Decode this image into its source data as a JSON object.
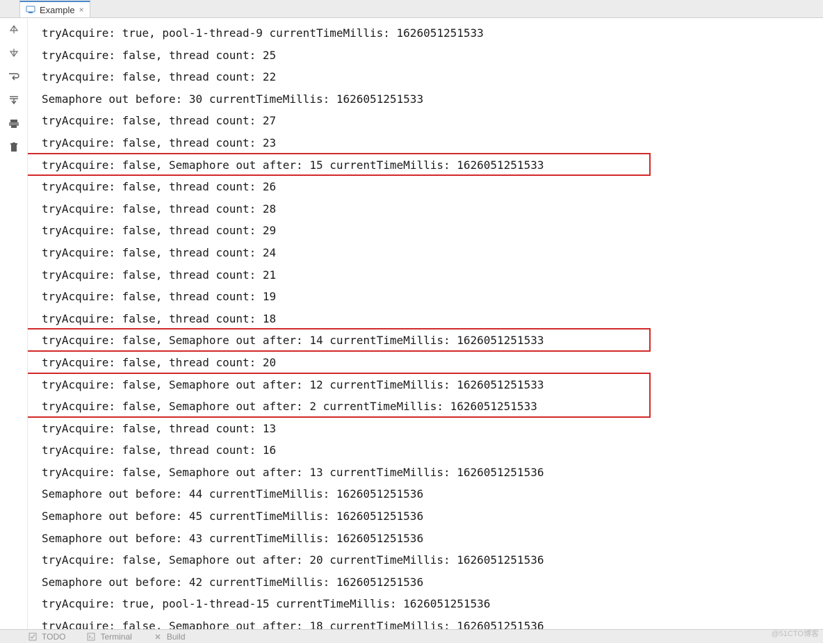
{
  "tab": {
    "label": "Example"
  },
  "gutter": {
    "up": "arrow-up-icon",
    "down": "arrow-down-icon",
    "wrap": "soft-wrap-icon",
    "scroll": "scroll-to-end-icon",
    "print": "print-icon",
    "trash": "trash-icon"
  },
  "console": {
    "lines": [
      "tryAcquire: true, pool-1-thread-9 currentTimeMillis: 1626051251533",
      "tryAcquire: false, thread count: 25",
      "tryAcquire: false, thread count: 22",
      "Semaphore out before: 30 currentTimeMillis: 1626051251533",
      "tryAcquire: false, thread count: 27",
      "tryAcquire: false, thread count: 23",
      "tryAcquire: false, Semaphore out after: 15 currentTimeMillis: 1626051251533",
      "tryAcquire: false, thread count: 26",
      "tryAcquire: false, thread count: 28",
      "tryAcquire: false, thread count: 29",
      "tryAcquire: false, thread count: 24",
      "tryAcquire: false, thread count: 21",
      "tryAcquire: false, thread count: 19",
      "tryAcquire: false, thread count: 18",
      "tryAcquire: false, Semaphore out after: 14 currentTimeMillis: 1626051251533",
      "tryAcquire: false, thread count: 20",
      "tryAcquire: false, Semaphore out after: 12 currentTimeMillis: 1626051251533",
      "tryAcquire: false, Semaphore out after: 2 currentTimeMillis: 1626051251533",
      "tryAcquire: false, thread count: 13",
      "tryAcquire: false, thread count: 16",
      "tryAcquire: false, Semaphore out after: 13 currentTimeMillis: 1626051251536",
      "Semaphore out before: 44 currentTimeMillis: 1626051251536",
      "Semaphore out before: 45 currentTimeMillis: 1626051251536",
      "Semaphore out before: 43 currentTimeMillis: 1626051251536",
      "tryAcquire: false, Semaphore out after: 20 currentTimeMillis: 1626051251536",
      "Semaphore out before: 42 currentTimeMillis: 1626051251536",
      "tryAcquire: true, pool-1-thread-15 currentTimeMillis: 1626051251536",
      "tryAcquire: false, Semaphore out after: 18 currentTimeMillis: 1626051251536"
    ]
  },
  "highlights": [
    {
      "start": 6,
      "end": 6
    },
    {
      "start": 14,
      "end": 14
    },
    {
      "start": 16,
      "end": 17
    }
  ],
  "bottombar": {
    "items": [
      "TODO",
      "Terminal",
      "Build"
    ]
  },
  "watermark": "@51CTO博客"
}
